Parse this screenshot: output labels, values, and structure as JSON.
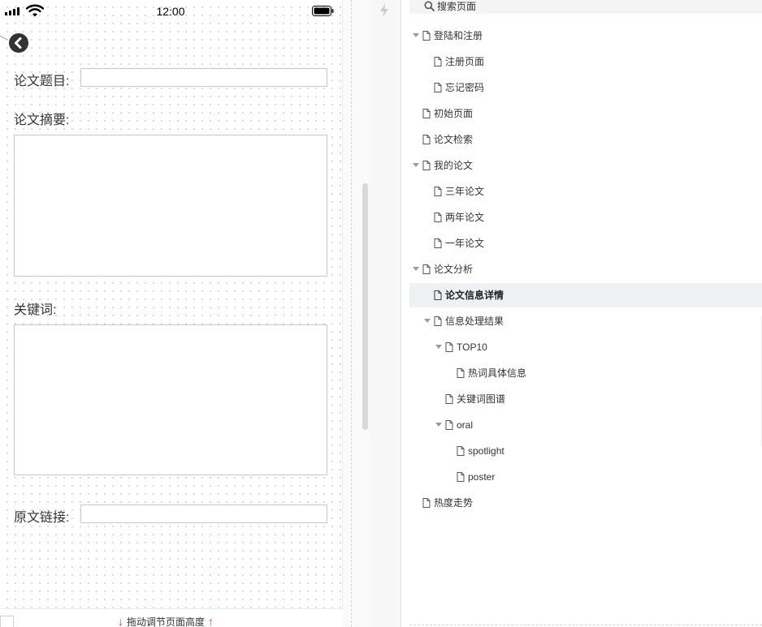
{
  "status_bar": {
    "time": "12:00"
  },
  "form": {
    "title_label": "论文题目:",
    "title_value": "",
    "abstract_label": "论文摘要:",
    "abstract_value": "",
    "keywords_label": "关键词:",
    "keywords_value": "",
    "link_label": "原文链接:",
    "link_value": ""
  },
  "bottom_bar": {
    "drag_hint": "拖动调节页面高度",
    "down_arrow": "↓",
    "up_arrow": "↑"
  },
  "page_tree": {
    "search_placeholder": "搜索页面",
    "rows": [
      {
        "label": "登陆和注册",
        "expanded": true
      },
      {
        "label": "注册页面"
      },
      {
        "label": "忘记密码"
      },
      {
        "label": "初始页面"
      },
      {
        "label": "论文检索"
      },
      {
        "label": "我的论文",
        "expanded": true
      },
      {
        "label": "三年论文"
      },
      {
        "label": "两年论文"
      },
      {
        "label": "一年论文"
      },
      {
        "label": "论文分析",
        "expanded": true
      },
      {
        "label": "论文信息详情",
        "selected": true
      },
      {
        "label": "信息处理结果",
        "expanded": true
      },
      {
        "label": "TOP10",
        "expanded": true
      },
      {
        "label": "热词具体信息"
      },
      {
        "label": "关键词图谱"
      },
      {
        "label": "oral",
        "expanded": true
      },
      {
        "label": "spotlight"
      },
      {
        "label": "poster"
      },
      {
        "label": "热度走势"
      }
    ]
  },
  "icons": {
    "back": "chevron-left-circle-icon",
    "signal": "signal-icon",
    "wifi": "wifi-icon",
    "battery": "battery-icon",
    "bolt": "lightning-icon",
    "search": "search-icon",
    "page": "page-icon",
    "caret": "caret-down-icon"
  },
  "colors": {
    "accent_arrow": "#e0433a",
    "selected_row": "#eef0f3",
    "text": "#333333"
  }
}
